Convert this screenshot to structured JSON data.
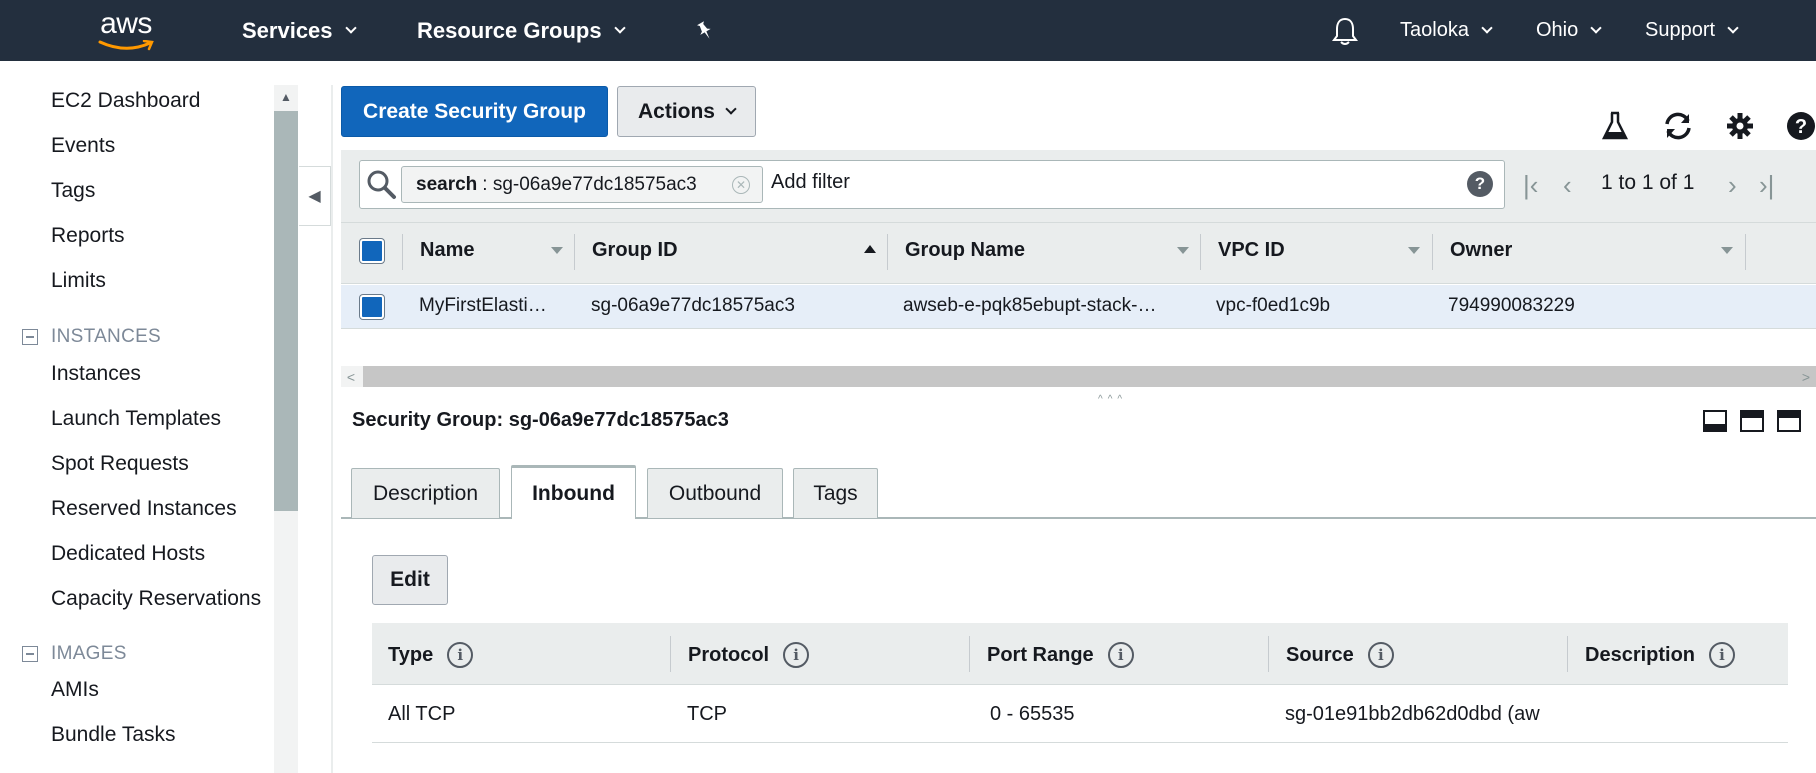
{
  "topnav": {
    "logo": "aws",
    "services": "Services",
    "resource_groups": "Resource Groups",
    "user": "Taoloka",
    "region": "Ohio",
    "support": "Support"
  },
  "sidebar": {
    "items_top": [
      "EC2 Dashboard",
      "Events",
      "Tags",
      "Reports",
      "Limits"
    ],
    "instances_header": "INSTANCES",
    "instances_items": [
      "Instances",
      "Launch Templates",
      "Spot Requests",
      "Reserved Instances",
      "Dedicated Hosts",
      "Capacity Reservations"
    ],
    "images_header": "IMAGES",
    "images_items": [
      "AMIs",
      "Bundle Tasks"
    ]
  },
  "toolbar": {
    "create_label": "Create Security Group",
    "actions_label": "Actions"
  },
  "filter": {
    "token_key": "search",
    "token_value": ": sg-06a9e77dc18575ac3",
    "add_filter": "Add filter",
    "pager_text": "1 to 1 of 1"
  },
  "table": {
    "columns": [
      "Name",
      "Group ID",
      "Group Name",
      "VPC ID",
      "Owner"
    ],
    "rows": [
      {
        "name": "MyFirstElasti…",
        "group_id": "sg-06a9e77dc18575ac3",
        "group_name": "awseb-e-pqk85ebupt-stack-…",
        "vpc_id": "vpc-f0ed1c9b",
        "owner": "794990083229"
      }
    ]
  },
  "detail": {
    "title": "Security Group: sg-06a9e77dc18575ac3",
    "tabs": [
      "Description",
      "Inbound",
      "Outbound",
      "Tags"
    ],
    "active_tab": "Inbound",
    "edit_label": "Edit",
    "rule_columns": [
      "Type",
      "Protocol",
      "Port Range",
      "Source",
      "Description"
    ],
    "rules": [
      {
        "type": "All TCP",
        "protocol": "TCP",
        "port_range": "0 - 65535",
        "source": "sg-01e91bb2db62d0dbd (aw",
        "description": ""
      }
    ]
  },
  "colors": {
    "nav_bg": "#232f3e",
    "primary": "#1166bb",
    "selected_row": "#e6eef8"
  }
}
